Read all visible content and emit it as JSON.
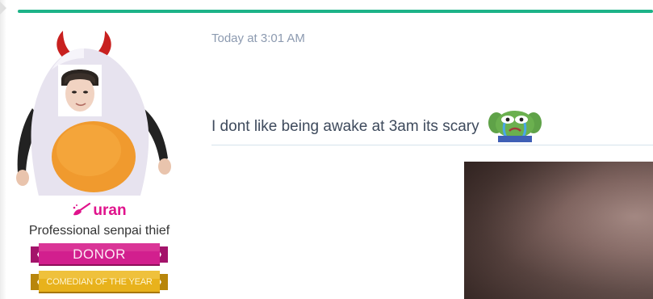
{
  "user": {
    "username": "uran",
    "title": "Professional senpai thief",
    "avatar_icon": "egg-costume-avatar",
    "username_icon": "broom-icon",
    "username_color": "#e0138c",
    "banners": [
      {
        "label": "DONOR",
        "color": "#d21f8e"
      },
      {
        "label": "COMEDIAN OF THE YEAR",
        "color": "#e8b21c"
      }
    ]
  },
  "message": {
    "timestamp": "Today at 3:01 AM",
    "text": "I dont like being awake at 3am its scary",
    "emote_icon": "crying-frog-emote",
    "attachment_icon": "image-attachment"
  },
  "theme": {
    "accent": "#1db388",
    "divider": "#d6e4ec",
    "timestamp_color": "#8c9ab0",
    "text_color": "#3e4a5c"
  }
}
